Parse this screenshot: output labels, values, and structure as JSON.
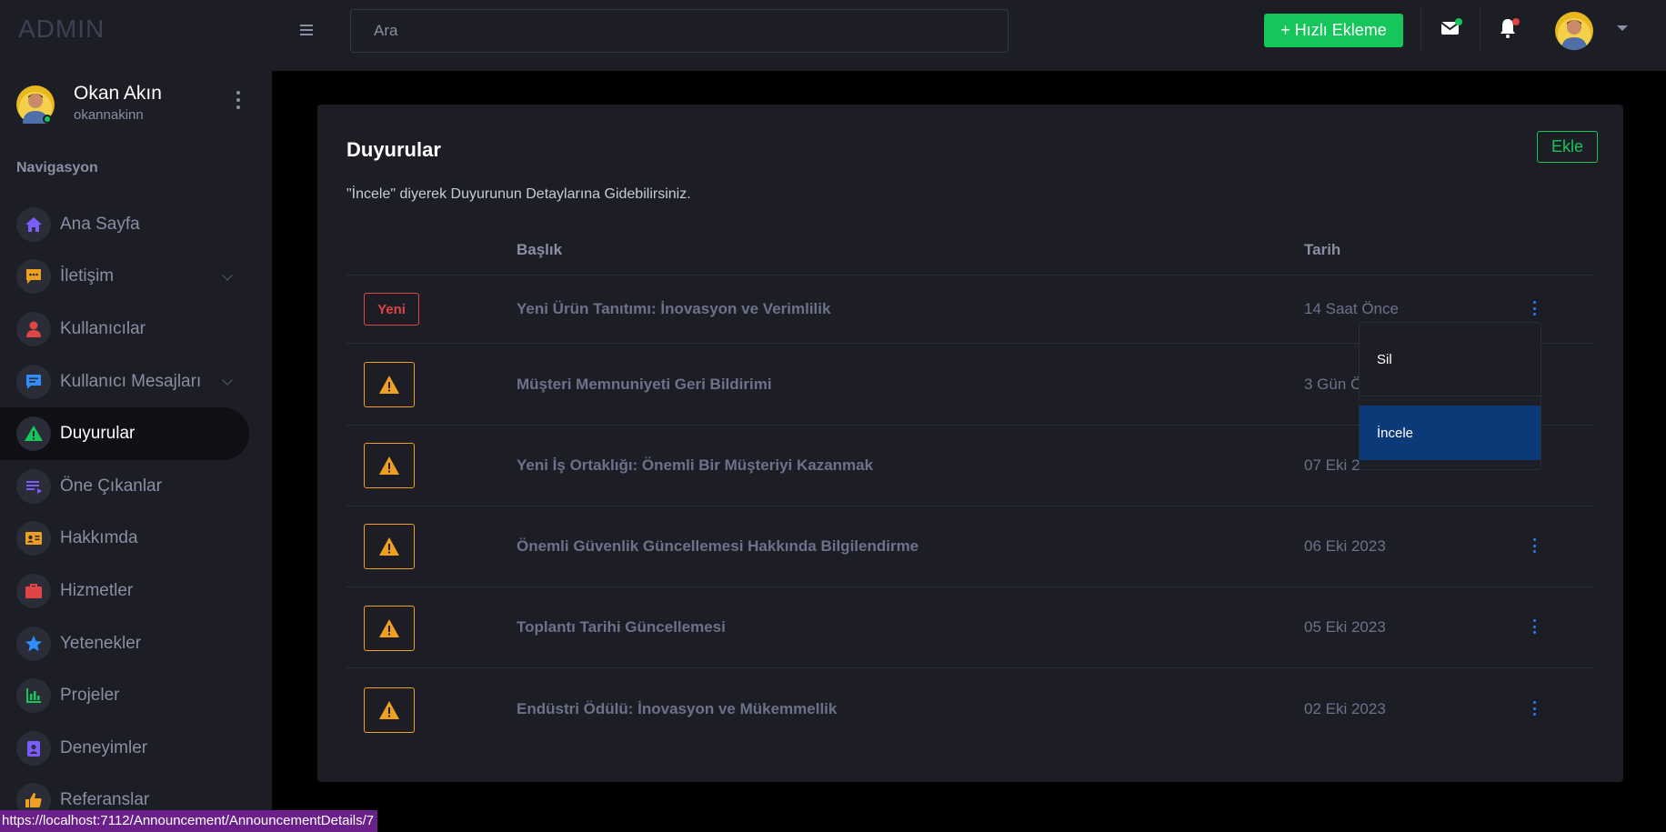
{
  "topbar": {
    "brand": "ADMIN",
    "search_placeholder": "Ara",
    "quick_add_label": "+ Hızlı Ekleme"
  },
  "sidebar": {
    "profile": {
      "name": "Okan Akın",
      "username": "okannakinn"
    },
    "nav_heading": "Navigasyon",
    "items": [
      {
        "label": "Ana Sayfa",
        "icon": "home-icon",
        "color": "#7c5cff"
      },
      {
        "label": "İletişim",
        "icon": "chat-icon",
        "color": "#f0a020"
      },
      {
        "label": "Kullanıcılar",
        "icon": "user-icon",
        "color": "#e04545"
      },
      {
        "label": "Kullanıcı Mesajları",
        "icon": "message-icon",
        "color": "#2f8fff"
      },
      {
        "label": "Duyurular",
        "icon": "warning-icon",
        "color": "#16c65a"
      },
      {
        "label": "Öne Çıkanlar",
        "icon": "list-icon",
        "color": "#7c5cff"
      },
      {
        "label": "Hakkımda",
        "icon": "id-card-icon",
        "color": "#f0a020"
      },
      {
        "label": "Hizmetler",
        "icon": "briefcase-icon",
        "color": "#e04545"
      },
      {
        "label": "Yetenekler",
        "icon": "star-icon",
        "color": "#2f8fff"
      },
      {
        "label": "Projeler",
        "icon": "bar-chart-icon",
        "color": "#16c65a"
      },
      {
        "label": "Deneyimler",
        "icon": "contact-icon",
        "color": "#7c5cff"
      },
      {
        "label": "Referanslar",
        "icon": "thumbs-up-icon",
        "color": "#f0a020"
      }
    ]
  },
  "main": {
    "title": "Duyurular",
    "add_label": "Ekle",
    "subtitle": "\"İncele\" diyerek Duyurunun Detaylarına Gidebilirsiniz.",
    "columns": {
      "title": "Başlık",
      "date": "Tarih"
    },
    "rows": [
      {
        "badge": "Yeni",
        "title": "Yeni Ürün Tanıtımı: İnovasyon ve Verimlilik",
        "date": "14 Saat Önce"
      },
      {
        "badge": "warning",
        "title": "Müşteri Memnuniyeti Geri Bildirimi",
        "date": "3 Gün Ö"
      },
      {
        "badge": "warning",
        "title": "Yeni İş Ortaklığı: Önemli Bir Müşteriyi Kazanmak",
        "date": "07 Eki 2"
      },
      {
        "badge": "warning",
        "title": "Önemli Güvenlik Güncellemesi Hakkında Bilgilendirme",
        "date": "06 Eki 2023"
      },
      {
        "badge": "warning",
        "title": "Toplantı Tarihi Güncellemesi",
        "date": "05 Eki 2023"
      },
      {
        "badge": "warning",
        "title": "Endüstri Ödülü: İnovasyon ve Mükemmellik",
        "date": "02 Eki 2023"
      }
    ],
    "dropdown": {
      "delete_label": "Sil",
      "view_label": "İncele"
    }
  },
  "statusbar": {
    "url": "https://localhost:7112/Announcement/AnnouncementDetails/7"
  },
  "colors": {
    "accent_green": "#16c65a",
    "warning": "#f0a020",
    "danger": "#e04545",
    "link_blue": "#2f7bff",
    "dropdown_active": "#0c3a78"
  }
}
